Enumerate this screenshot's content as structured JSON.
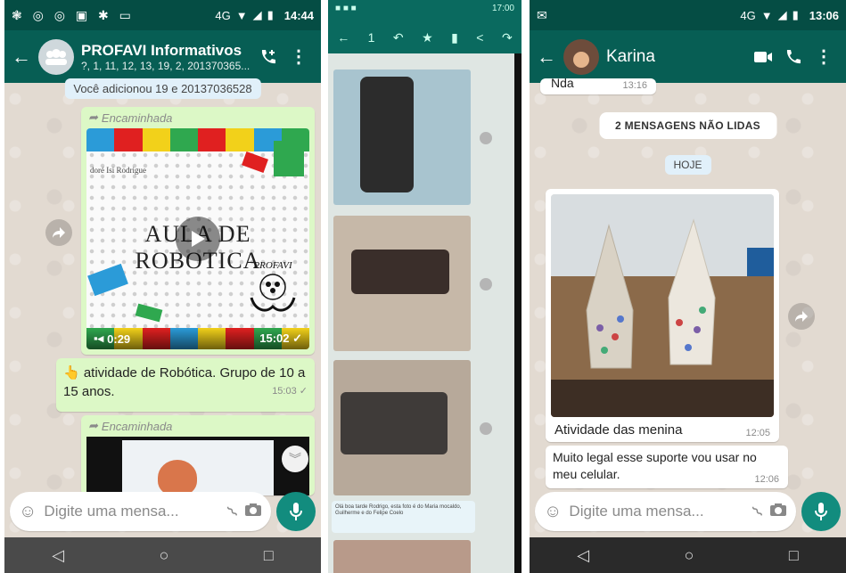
{
  "phone1": {
    "status": {
      "left": "❃ ◎ ◎ ▣ ✱ ▭",
      "network": "4G",
      "time": "14:44"
    },
    "header": {
      "title": "PROFAVI Informativos",
      "subtitle": "?, 1, 11, 12, 13, 19, 2, 201370365..."
    },
    "system_message": "Você adicionou 19 e 20137036528",
    "video_message": {
      "forward_label": "Encaminhada",
      "duration": "0:29",
      "time": "15:02 ✓",
      "image_text": "AULA DE ROBOTICA",
      "image_caption_small": "doré Isi Rodrigue",
      "logo_text": "PROFAVI"
    },
    "text_message": {
      "text": "👆 atividade de Robótica. Grupo de 10 a 15 anos.",
      "time": "15:03 ✓"
    },
    "third_message": {
      "forward_label": "Encaminhada"
    },
    "composer": {
      "placeholder": "Digite uma mensa..."
    }
  },
  "phone2": {
    "status": {
      "left": "■ ■ ■",
      "right": "17:00"
    },
    "actions": [
      "←",
      "1",
      "↶",
      "★",
      "▮",
      "<",
      "↷"
    ],
    "caption": "Olá boa tarde Rodrigo, esta foto é do Maria mocaldo, Guilherme e do Felipe Coelo"
  },
  "phone3": {
    "status": {
      "network": "4G",
      "time": "13:06"
    },
    "header": {
      "title": "Karina"
    },
    "first_message": {
      "text": "Nda",
      "time": "13:16"
    },
    "unread": "2 MENSAGENS NÃO LIDAS",
    "date": "HOJE",
    "image_message": {
      "caption": "Atividade das menina",
      "time": "12:05"
    },
    "text_message": {
      "text": "Muito legal esse suporte vou usar no meu celular.",
      "time": "12:06"
    },
    "composer": {
      "placeholder": "Digite uma mensa..."
    }
  },
  "navbar": {
    "back": "◁",
    "home": "○",
    "recent": "□"
  }
}
